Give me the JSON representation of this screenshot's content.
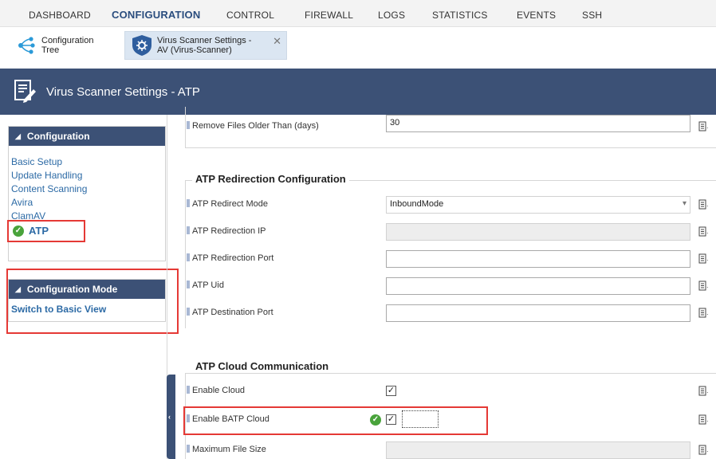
{
  "topmenu": {
    "items": [
      "DASHBOARD",
      "CONFIGURATION",
      "CONTROL",
      "FIREWALL",
      "LOGS",
      "STATISTICS",
      "EVENTS",
      "SSH"
    ]
  },
  "tabs": {
    "config_tree": "Configuration\nTree",
    "virus_tab": "Virus Scanner Settings -\nAV (Virus-Scanner)",
    "close": "✕"
  },
  "header": {
    "title": "Virus Scanner Settings - ATP"
  },
  "left": {
    "config_section": "Configuration",
    "links": [
      "Basic Setup",
      "Update Handling",
      "Content Scanning",
      "Avira",
      "ClamAV"
    ],
    "atp": "ATP",
    "mode_section": "Configuration Mode",
    "switch_link": "Switch to Basic View",
    "collapse_arrow": "‹"
  },
  "form": {
    "remove_files_label": "Remove Files Older Than (days)",
    "remove_files_value": "30",
    "redirection_group": "ATP Redirection Configuration",
    "redirect_mode_label": "ATP Redirect Mode",
    "redirect_mode_value": "InboundMode",
    "redirection_ip_label": "ATP Redirection IP",
    "redirection_port_label": "ATP Redirection Port",
    "uid_label": "ATP Uid",
    "dest_port_label": "ATP Destination Port",
    "cloud_group": "ATP Cloud Communication",
    "enable_cloud_label": "Enable Cloud",
    "enable_batp_label": "Enable BATP Cloud",
    "max_file_size_label": "Maximum File Size",
    "checkmark": "✓"
  },
  "colors": {
    "header_bg": "#3c5176",
    "link": "#2c6aa5",
    "highlight": "#e53935",
    "ok_green": "#49a33b"
  }
}
